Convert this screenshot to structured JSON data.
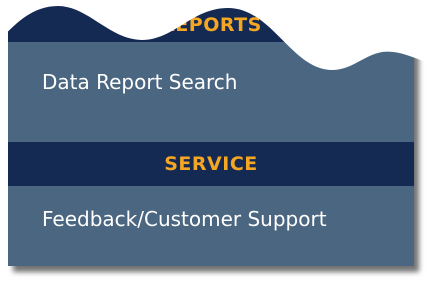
{
  "reports_section": {
    "header_label": "REPORTS",
    "link_label": "Data Report Search"
  },
  "service_section": {
    "header_label": "SERVICE",
    "link_label": "Feedback/Customer Support"
  },
  "colors": {
    "panel_bg": "#4a6680",
    "header_bg": "#152a52",
    "header_text": "#f5a623",
    "link_text": "#ffffff"
  }
}
